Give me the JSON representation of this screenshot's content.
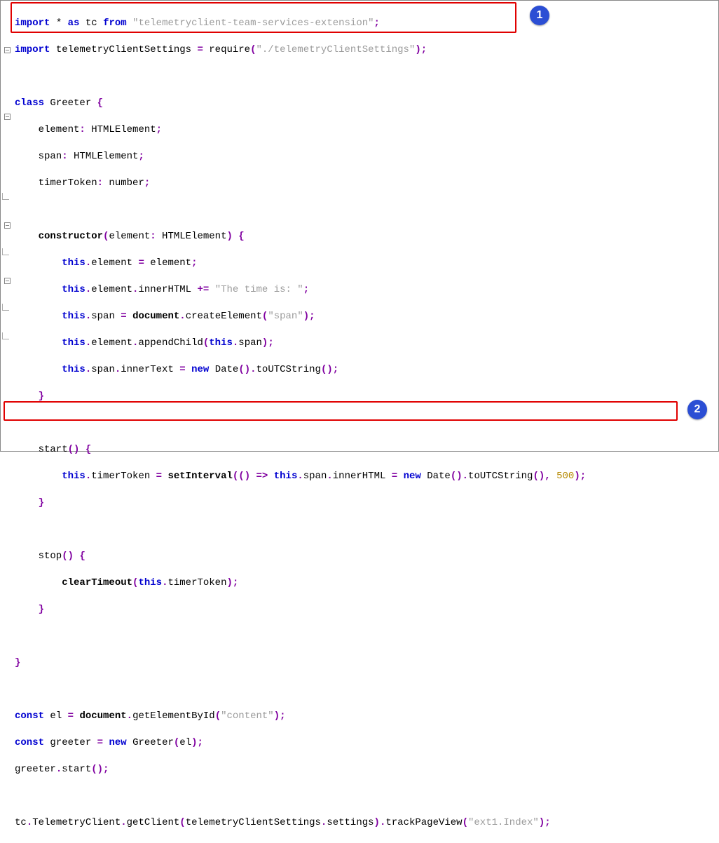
{
  "callouts": {
    "one": "1",
    "two": "2"
  },
  "colors": {
    "highlight": "#e00000",
    "callout_bg": "#2b4ed4"
  },
  "code": {
    "l1": {
      "a": "import",
      "b": " * ",
      "c": "as",
      "d": " tc ",
      "e": "from",
      "f": " ",
      "g": "\"telemetryclient-team-services-extension\"",
      "h": ";"
    },
    "l2": {
      "a": "import",
      "b": " telemetryClientSettings ",
      "c": "=",
      "d": " require",
      "e": "(",
      "f": "\"./telemetryClientSettings\"",
      "g": ")",
      "h": ";"
    },
    "l4": {
      "a": "class",
      "b": " Greeter ",
      "c": "{"
    },
    "l5": {
      "a": "    element",
      "b": ":",
      "c": " HTMLElement",
      "d": ";"
    },
    "l6": {
      "a": "    span",
      "b": ":",
      "c": " HTMLElement",
      "d": ";"
    },
    "l7": {
      "a": "    timerToken",
      "b": ":",
      "c": " number",
      "d": ";"
    },
    "l9": {
      "a": "    ",
      "b": "constructor",
      "c": "(",
      "d": "element",
      "e": ":",
      "f": " HTMLElement",
      "g": ")",
      "h": " ",
      "i": "{"
    },
    "l10": {
      "a": "        ",
      "b": "this",
      "c": ".",
      "d": "element ",
      "e": "=",
      "f": " element",
      "g": ";"
    },
    "l11": {
      "a": "        ",
      "b": "this",
      "c": ".",
      "d": "element",
      "e": ".",
      "f": "innerHTML ",
      "g": "+=",
      "h": " ",
      "i": "\"The time is: \"",
      "j": ";"
    },
    "l12": {
      "a": "        ",
      "b": "this",
      "c": ".",
      "d": "span ",
      "e": "=",
      "f": " ",
      "g": "document",
      "h": ".",
      "i": "createElement",
      "j": "(",
      "k": "\"span\"",
      "l": ")",
      "m": ";"
    },
    "l13": {
      "a": "        ",
      "b": "this",
      "c": ".",
      "d": "element",
      "e": ".",
      "f": "appendChild",
      "g": "(",
      "h": "this",
      "i": ".",
      "j": "span",
      "k": ")",
      "l": ";"
    },
    "l14": {
      "a": "        ",
      "b": "this",
      "c": ".",
      "d": "span",
      "e": ".",
      "f": "innerText ",
      "g": "=",
      "h": " ",
      "i": "new",
      "j": " Date",
      "k": "()",
      "l": ".",
      "m": "toUTCString",
      "n": "()",
      "o": ";"
    },
    "l15": {
      "a": "    ",
      "b": "}"
    },
    "l17": {
      "a": "    start",
      "b": "()",
      "c": " ",
      "d": "{"
    },
    "l18": {
      "a": "        ",
      "b": "this",
      "c": ".",
      "d": "timerToken ",
      "e": "=",
      "f": " ",
      "g": "setInterval",
      "h": "((",
      "i": ")",
      "j": " ",
      "k": "=>",
      "l": " ",
      "m": "this",
      "n": ".",
      "o": "span",
      "p": ".",
      "q": "innerHTML ",
      "r": "=",
      "s": " ",
      "t": "new",
      "u": " Date",
      "v": "()",
      "w": ".",
      "x": "toUTCString",
      "y": "()",
      "z": ",",
      "aa": " ",
      "ab": "500",
      "ac": ")",
      "ad": ";"
    },
    "l19": {
      "a": "    ",
      "b": "}"
    },
    "l21": {
      "a": "    stop",
      "b": "()",
      "c": " ",
      "d": "{"
    },
    "l22": {
      "a": "        ",
      "b": "clearTimeout",
      "c": "(",
      "d": "this",
      "e": ".",
      "f": "timerToken",
      "g": ")",
      "h": ";"
    },
    "l23": {
      "a": "    ",
      "b": "}"
    },
    "l25": {
      "a": "}"
    },
    "l27": {
      "a": "const",
      "b": " el ",
      "c": "=",
      "d": " ",
      "e": "document",
      "f": ".",
      "g": "getElementById",
      "h": "(",
      "i": "\"content\"",
      "j": ")",
      "k": ";"
    },
    "l28": {
      "a": "const",
      "b": " greeter ",
      "c": "=",
      "d": " ",
      "e": "new",
      "f": " Greeter",
      "g": "(",
      "h": "el",
      "i": ")",
      "j": ";"
    },
    "l29": {
      "a": "greeter",
      "b": ".",
      "c": "start",
      "d": "()",
      "e": ";"
    },
    "l31": {
      "a": "tc",
      "b": ".",
      "c": "TelemetryClient",
      "d": ".",
      "e": "getClient",
      "f": "(",
      "g": "telemetryClientSettings",
      "h": ".",
      "i": "settings",
      "j": ")",
      "k": ".",
      "l": "trackPageView",
      "m": "(",
      "n": "\"ext1.Index\"",
      "o": ")",
      "p": ";"
    }
  }
}
